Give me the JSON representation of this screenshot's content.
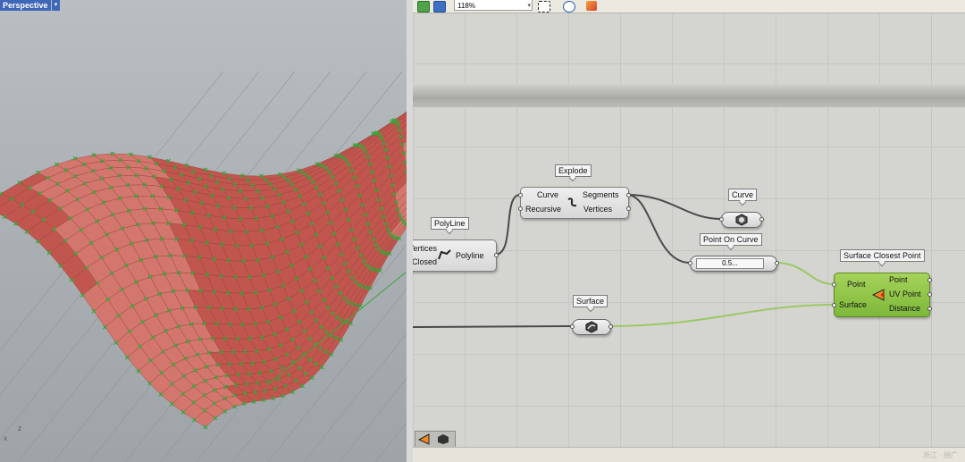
{
  "viewport": {
    "title": "Perspective",
    "axis_x_label": "x",
    "axis_z_label": "z"
  },
  "toolbar": {
    "zoom_value": "118%"
  },
  "components": {
    "explode": {
      "title": "Explode",
      "inputs": [
        "Curve",
        "Recursive"
      ],
      "outputs": [
        "Segments",
        "Vertices"
      ]
    },
    "polyline": {
      "title": "PolyLine",
      "inputs": [
        "Vertices",
        "Closed"
      ],
      "output": "Polyline"
    },
    "curve_param": {
      "title": "Curve"
    },
    "point_on_curve": {
      "title": "Point On Curve",
      "value": "0.5..."
    },
    "surface_param": {
      "title": "Surface"
    },
    "surface_closest_point": {
      "title": "Surface Closest Point",
      "inputs": [
        "Point",
        "Surface"
      ],
      "outputs": [
        "Point",
        "UV Point",
        "Distance"
      ]
    }
  },
  "status": {
    "watermark": "浙江 · 绢广"
  },
  "colors": {
    "surface_red": "#c0564e",
    "point_green": "#3aa33a",
    "component_green": "#8cc545",
    "viewport_tab": "#3f67b7"
  }
}
